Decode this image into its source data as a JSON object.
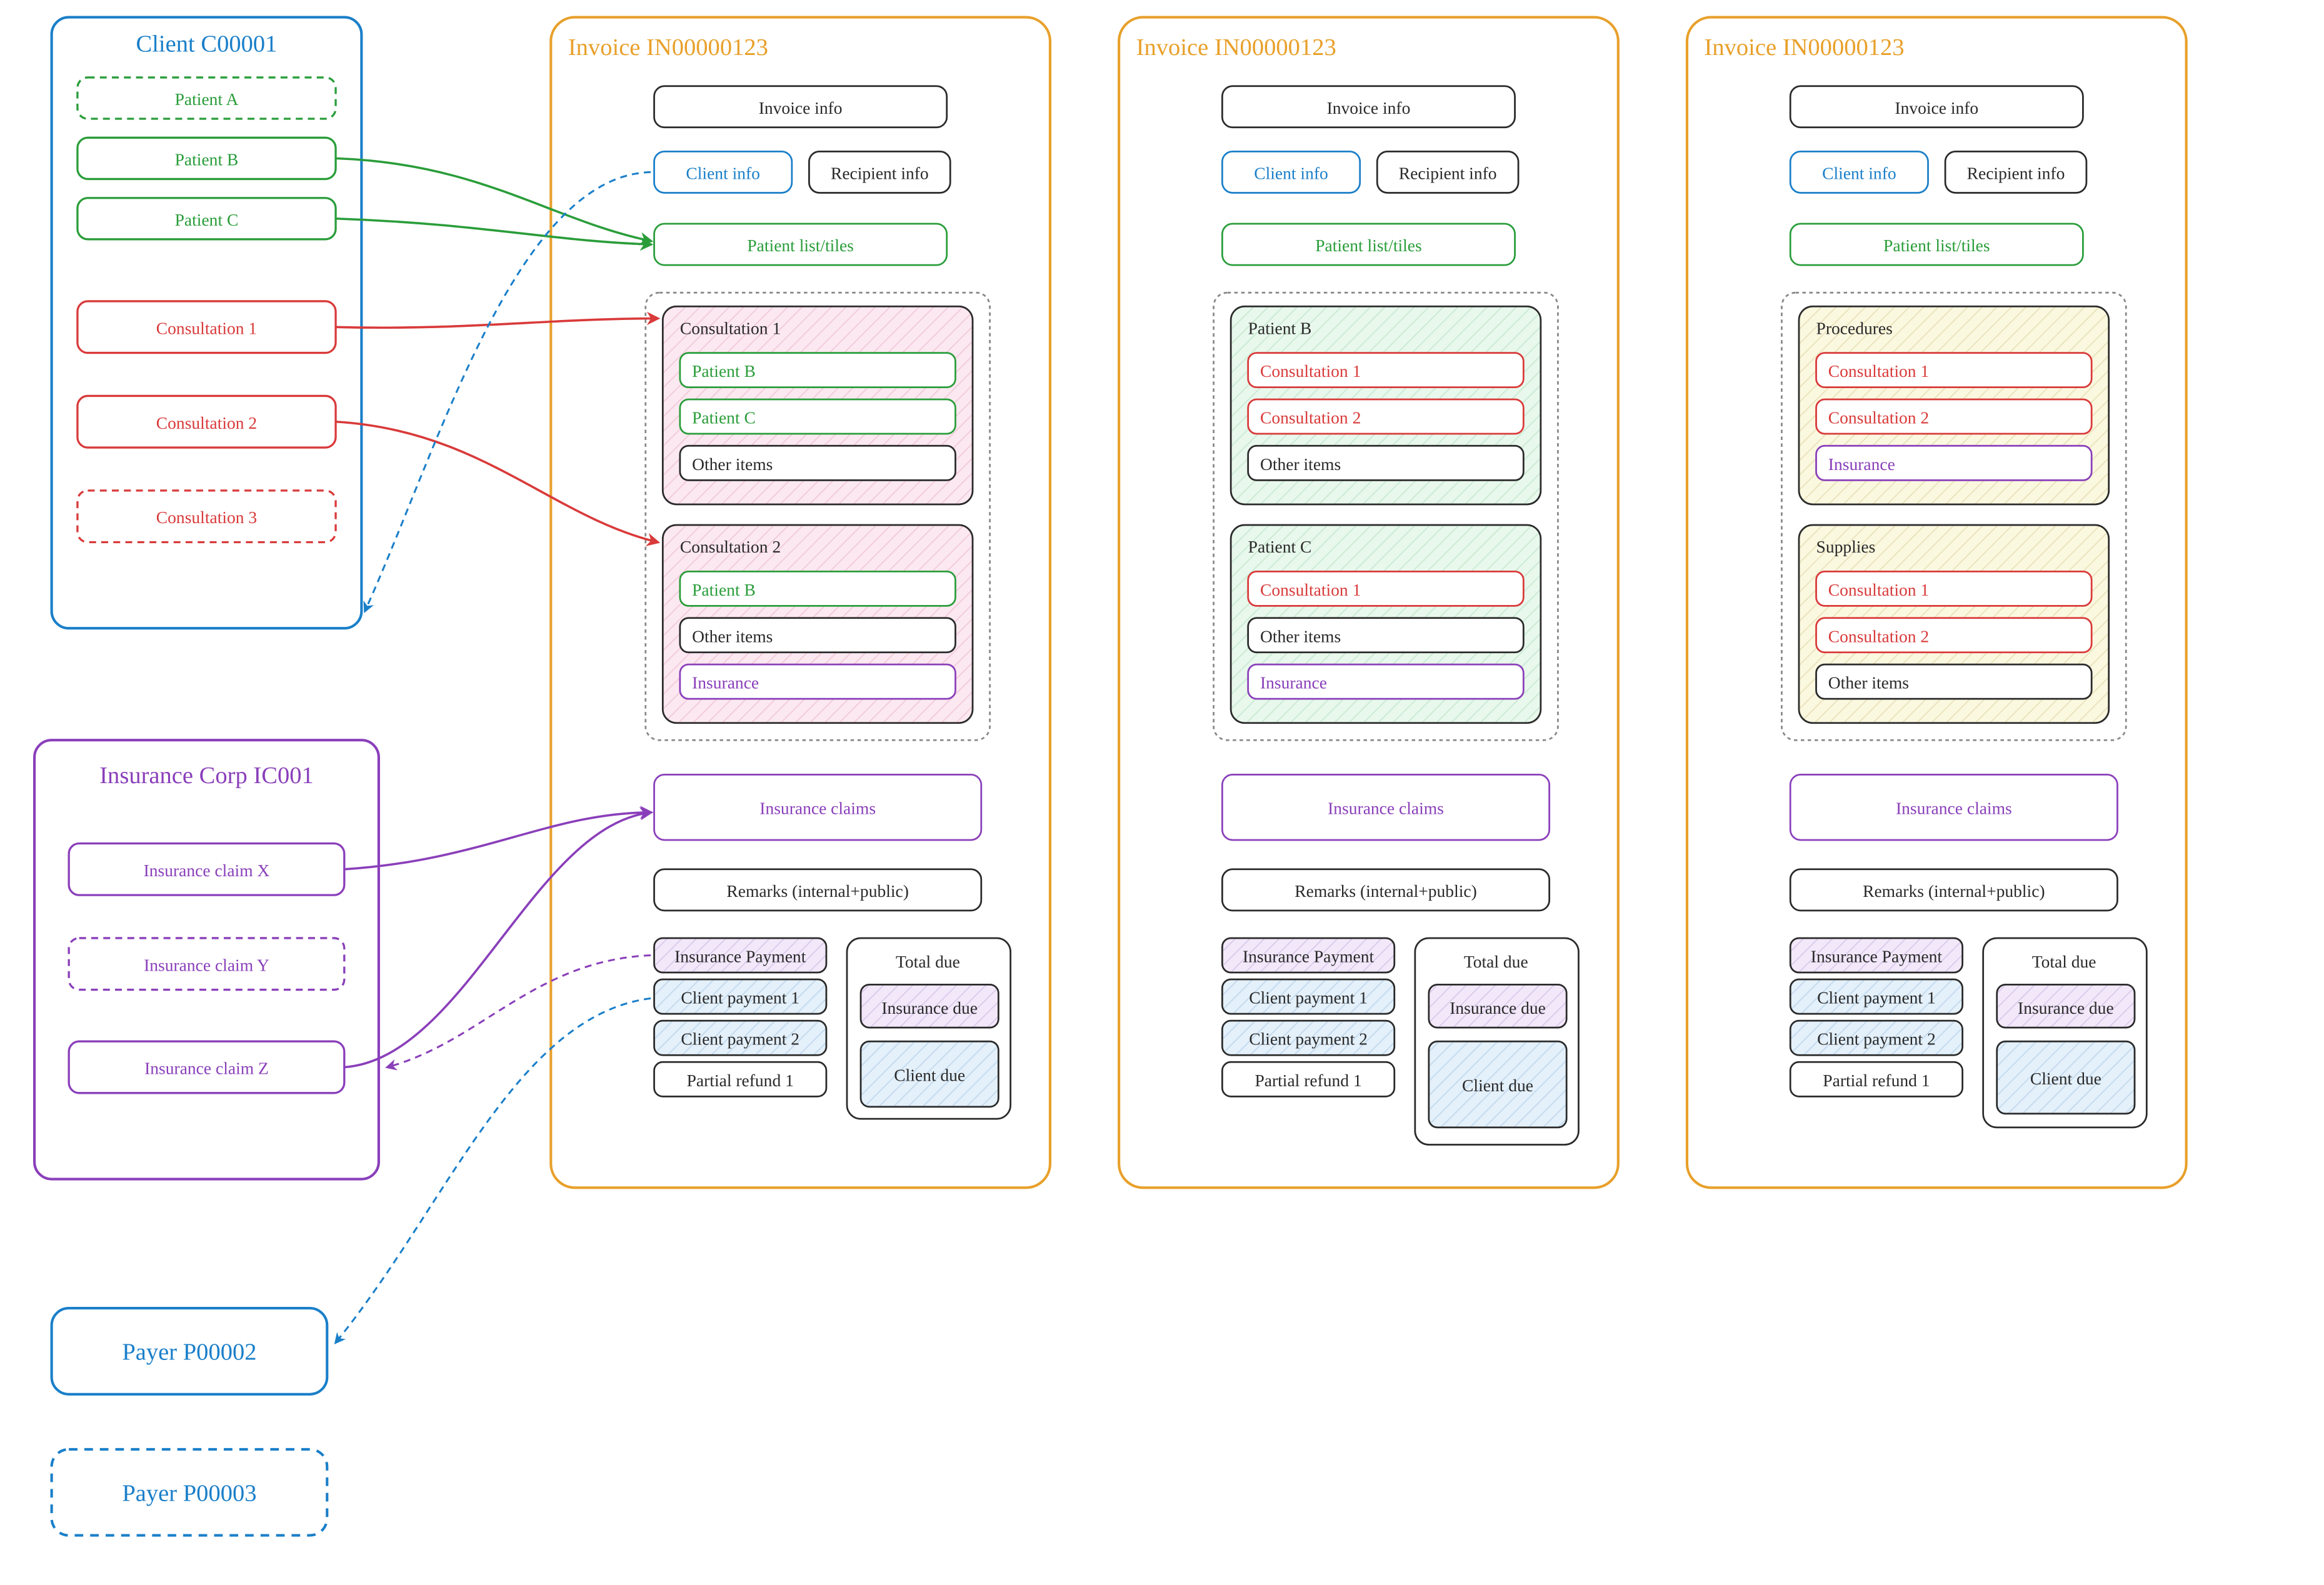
{
  "colors": {
    "blue": "#1a7fc9",
    "green": "#2a9d3a",
    "red": "#d93a3a",
    "purple": "#8a3fba",
    "orange": "#e8a02a",
    "black": "#2a2a2a",
    "pinkFill": "#fce8f0",
    "greenFill": "#e8f8ec",
    "yellowFill": "#fbf8e0",
    "purpleFill": "#f2e8fa",
    "blueFill": "#e4f0fa"
  },
  "client": {
    "title": "Client C00001",
    "patients": [
      "Patient A",
      "Patient B",
      "Patient C"
    ],
    "consultations": [
      "Consultation 1",
      "Consultation 2",
      "Consultation 3"
    ]
  },
  "insurance": {
    "title": "Insurance Corp IC001",
    "claims": [
      "Insurance claim X",
      "Insurance claim Y",
      "Insurance claim Z"
    ]
  },
  "payers": [
    "Payer P00002",
    "Payer P00003"
  ],
  "invoice1": {
    "title": "Invoice IN00000123",
    "invoiceInfo": "Invoice info",
    "clientInfo": "Client info",
    "recipientInfo": "Recipient info",
    "patientTiles": "Patient list/tiles",
    "group1": {
      "title": "Consultation 1",
      "items": [
        "Patient B",
        "Patient C",
        "Other items"
      ]
    },
    "group2": {
      "title": "Consultation 2",
      "items": [
        "Patient B",
        "Other items",
        "Insurance"
      ]
    },
    "insuranceClaims": "Insurance claims",
    "remarks": "Remarks (internal+public)",
    "payments": [
      "Insurance Payment",
      "Client payment 1",
      "Client payment 2",
      "Partial refund 1"
    ],
    "totalTitle": "Total due",
    "totalRows": [
      "Insurance due",
      "Client due"
    ]
  },
  "invoice2": {
    "title": "Invoice IN00000123",
    "invoiceInfo": "Invoice info",
    "clientInfo": "Client info",
    "recipientInfo": "Recipient info",
    "patientTiles": "Patient list/tiles",
    "group1": {
      "title": "Patient B",
      "items": [
        "Consultation 1",
        "Consultation 2",
        "Other items"
      ]
    },
    "group2": {
      "title": "Patient C",
      "items": [
        "Consultation 1",
        "Other items",
        "Insurance"
      ]
    },
    "insuranceClaims": "Insurance claims",
    "remarks": "Remarks (internal+public)",
    "payments": [
      "Insurance Payment",
      "Client payment 1",
      "Client payment 2",
      "Partial refund 1"
    ],
    "totalTitle": "Total due",
    "totalRows": [
      "Insurance due",
      "Client due"
    ]
  },
  "invoice3": {
    "title": "Invoice IN00000123",
    "invoiceInfo": "Invoice info",
    "clientInfo": "Client info",
    "recipientInfo": "Recipient info",
    "patientTiles": "Patient list/tiles",
    "group1": {
      "title": "Procedures",
      "items": [
        "Consultation 1",
        "Consultation 2",
        "Insurance"
      ]
    },
    "group2": {
      "title": "Supplies",
      "items": [
        "Consultation 1",
        "Consultation 2",
        "Other items"
      ]
    },
    "insuranceClaims": "Insurance claims",
    "remarks": "Remarks (internal+public)",
    "payments": [
      "Insurance Payment",
      "Client payment 1",
      "Client payment 2",
      "Partial refund 1"
    ],
    "totalTitle": "Total due",
    "totalRows": [
      "Insurance due",
      "Client due"
    ]
  }
}
